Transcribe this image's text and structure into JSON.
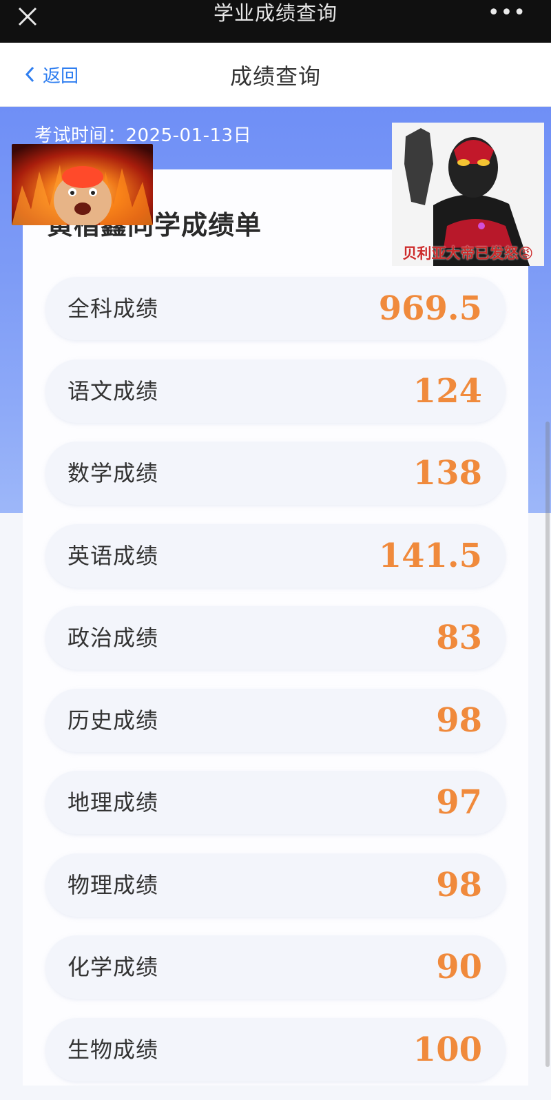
{
  "window": {
    "title": "学业成绩查询",
    "more_label": "•••"
  },
  "nav": {
    "back_label": "返回",
    "title": "成绩查询"
  },
  "header": {
    "exam_time": "考试时间：2025-01-13日"
  },
  "card": {
    "title": "黄楷鑫同学成绩单",
    "scores": [
      {
        "label": "全科成绩",
        "value": "969.5"
      },
      {
        "label": "语文成绩",
        "value": "124"
      },
      {
        "label": "数学成绩",
        "value": "138"
      },
      {
        "label": "英语成绩",
        "value": "141.5"
      },
      {
        "label": "政治成绩",
        "value": "83"
      },
      {
        "label": "历史成绩",
        "value": "98"
      },
      {
        "label": "地理成绩",
        "value": "97"
      },
      {
        "label": "物理成绩",
        "value": "98"
      },
      {
        "label": "化学成绩",
        "value": "90"
      },
      {
        "label": "生物成绩",
        "value": "100"
      }
    ]
  },
  "stickers": {
    "right_caption": "贝利亚大帝已发怒😡"
  },
  "colors": {
    "accent": "#2f7ef0",
    "header_blue": "#7d9bf6",
    "score_orange": "#f08a3c"
  }
}
